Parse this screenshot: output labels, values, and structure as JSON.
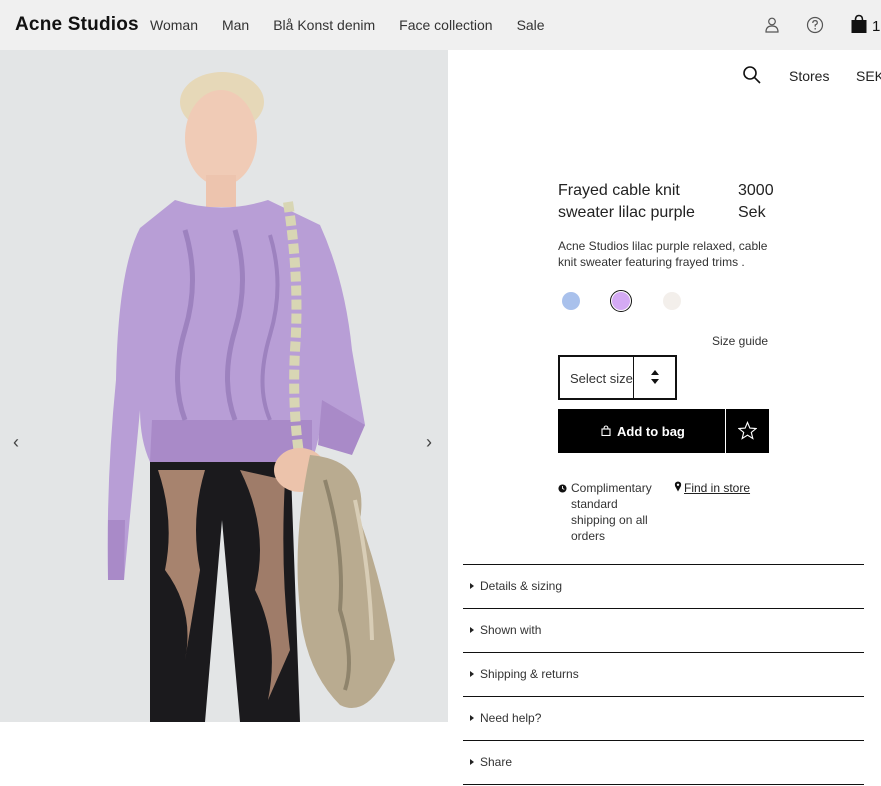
{
  "header": {
    "logo": "Acne Studios",
    "nav": [
      "Woman",
      "Man",
      "Blå Konst denim",
      "Face collection",
      "Sale"
    ],
    "bag_count": "1"
  },
  "topbar": {
    "stores": "Stores",
    "currency": "SEK"
  },
  "product": {
    "name": "Frayed cable knit sweater lilac purple",
    "price": "3000 Sek",
    "description": "Acne Studios lilac purple relaxed, cable knit sweater featuring frayed trims .",
    "swatches": [
      {
        "color": "#a9c1ec",
        "selected": false
      },
      {
        "color": "#d4aaf4",
        "selected": true
      },
      {
        "color": "#f3efeb",
        "selected": false
      }
    ],
    "size_guide": "Size guide",
    "size_placeholder": "Select size",
    "add_to_bag": "Add to bag",
    "shipping": "Complimentary standard shipping on all orders",
    "find_in_store": "Find in store"
  },
  "accordion": [
    "Details & sizing",
    "Shown with",
    "Shipping & returns",
    "Need help?",
    "Share"
  ],
  "icons": [
    "account-icon",
    "help-icon",
    "shopping-bag-icon",
    "search-icon",
    "chevron-left-icon",
    "chevron-right-icon",
    "star-icon",
    "clock-icon",
    "map-pin-icon",
    "lock-bag-icon"
  ]
}
